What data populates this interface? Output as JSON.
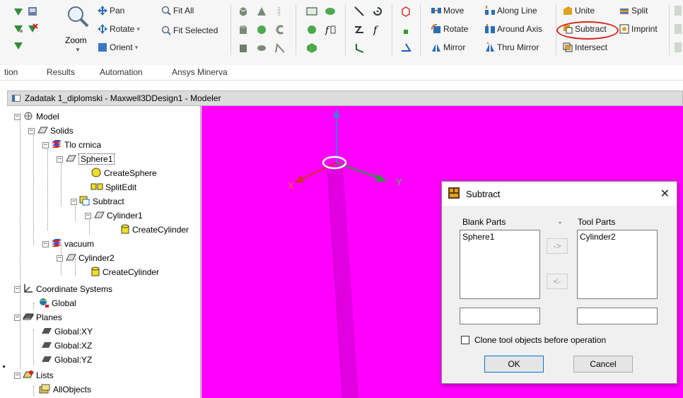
{
  "ribbon": {
    "view": {
      "pan": "Pan",
      "rotate": "Rotate",
      "orient": "Orient",
      "zoom": "Zoom",
      "fit_all": "Fit All",
      "fit_selected": "Fit Selected"
    },
    "transform": {
      "move": "Move",
      "rotate": "Rotate",
      "mirror": "Mirror",
      "along_line": "Along Line",
      "around_axis": "Around Axis",
      "thru_mirror": "Thru Mirror"
    },
    "boolean": {
      "unite": "Unite",
      "subtract": "Subtract",
      "intersect": "Intersect",
      "split": "Split",
      "imprint": "Imprint"
    },
    "highlight_color": "#d9261c"
  },
  "tabs": [
    "tion",
    "Results",
    "Automation",
    "Ansys Minerva"
  ],
  "window": {
    "title": "Zadatak 1_diplomski - Maxwell3DDesign1 - Modeler"
  },
  "tree": {
    "model": "Model",
    "solids": "Solids",
    "tlo_crnica": "Tlo crnica",
    "sphere1": "Sphere1",
    "create_sphere": "CreateSphere",
    "split_edit": "SplitEdit",
    "subtract": "Subtract",
    "cylinder1": "Cylinder1",
    "create_cylinder_1": "CreateCylinder",
    "vacuum": "vacuum",
    "cylinder2": "Cylinder2",
    "create_cylinder_2": "CreateCylinder",
    "coordinate_systems": "Coordinate Systems",
    "global": "Global",
    "planes": "Planes",
    "plane_xy": "Global:XY",
    "plane_xz": "Global:XZ",
    "plane_yz": "Global:YZ",
    "lists": "Lists",
    "all_objects": "AllObjects"
  },
  "viewport": {
    "background": "#ff00ff",
    "axis_x": "X",
    "axis_y": "Y"
  },
  "dialog": {
    "title": "Subtract",
    "blank_parts_label": "Blank Parts",
    "dash": "-",
    "tool_parts_label": "Tool Parts",
    "blank_parts": [
      "Sphere1"
    ],
    "tool_parts": [
      "Cylinder2"
    ],
    "move_right": "->",
    "move_left": "<-",
    "clone_label": "Clone tool objects before operation",
    "clone_checked": false,
    "ok": "OK",
    "cancel": "Cancel"
  }
}
